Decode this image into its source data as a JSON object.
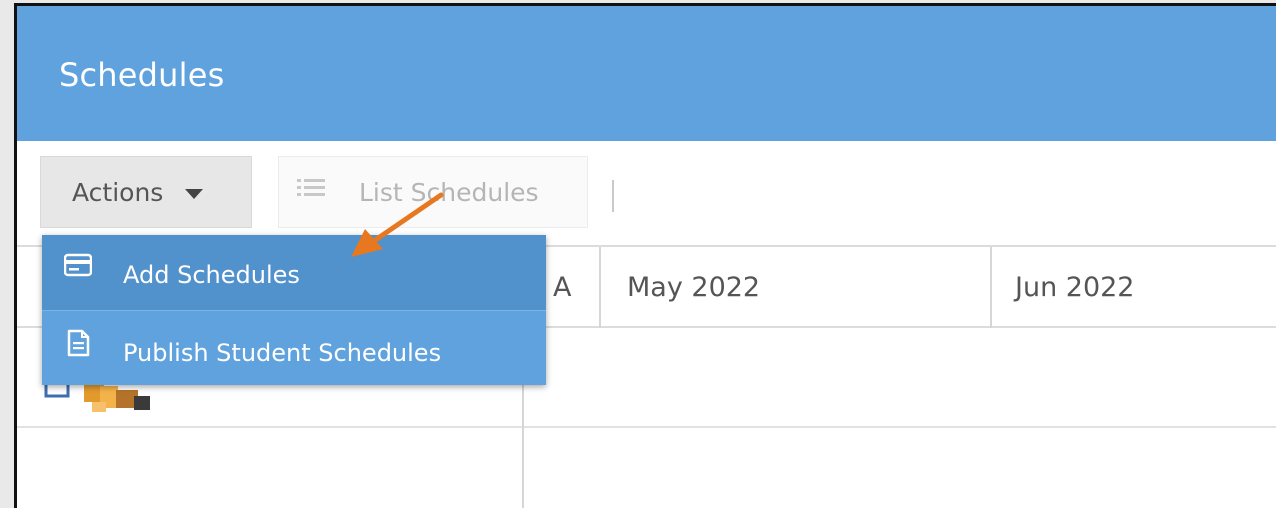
{
  "header": {
    "title": "Schedules"
  },
  "toolbar": {
    "actions_label": "Actions",
    "list_label": "List Schedules"
  },
  "grid": {
    "columns": [
      "A",
      "May 2022",
      "Jun 2022"
    ]
  },
  "menu": {
    "items": [
      {
        "label": "Add Schedules",
        "icon": "credit-card-icon"
      },
      {
        "label": "Publish Student Schedules",
        "icon": "document-icon"
      }
    ]
  },
  "colors": {
    "header": "#5fa2dd",
    "menu": "#5fa2dd",
    "menu_highlight": "#5191cc",
    "annotation_arrow": "#e8781f"
  }
}
